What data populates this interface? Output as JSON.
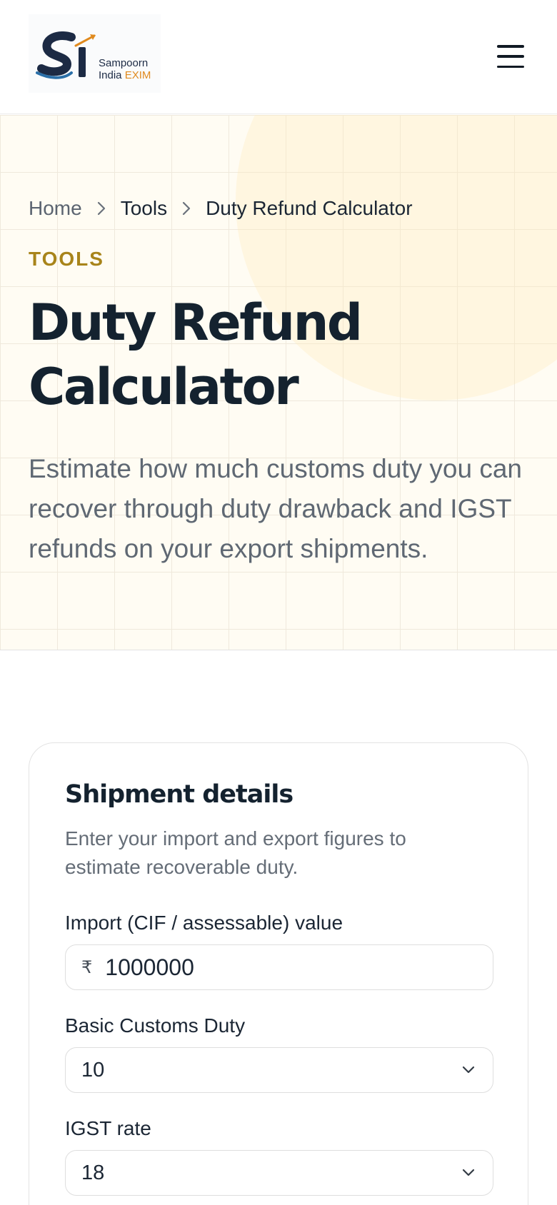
{
  "brand": {
    "name_line1": "Sampoorn",
    "name_line2": "India",
    "name_accent": "EXIM",
    "accent_color": "#e08a1e",
    "primary_color": "#1c2a44"
  },
  "header": {
    "menu_icon": "hamburger-menu-icon"
  },
  "breadcrumb": {
    "home": "Home",
    "tools": "Tools",
    "current": "Duty Refund Calculator",
    "separator_icon": "chevron-right-icon"
  },
  "hero": {
    "eyebrow": "TOOLS",
    "eyebrow_color": "#a8841a",
    "title": "Duty Refund Calculator",
    "subtitle": "Estimate how much customs duty you can recover through duty drawback and IGST refunds on your export shipments."
  },
  "form": {
    "title": "Shipment details",
    "subtitle": "Enter your import and export figures to estimate recoverable duty.",
    "fields": [
      {
        "label": "Import (CIF / assessable) value",
        "currency_symbol": "₹",
        "value": "1000000"
      },
      {
        "label": "Basic Customs Duty",
        "value": "10"
      },
      {
        "label": "IGST rate",
        "value": "18"
      }
    ]
  }
}
